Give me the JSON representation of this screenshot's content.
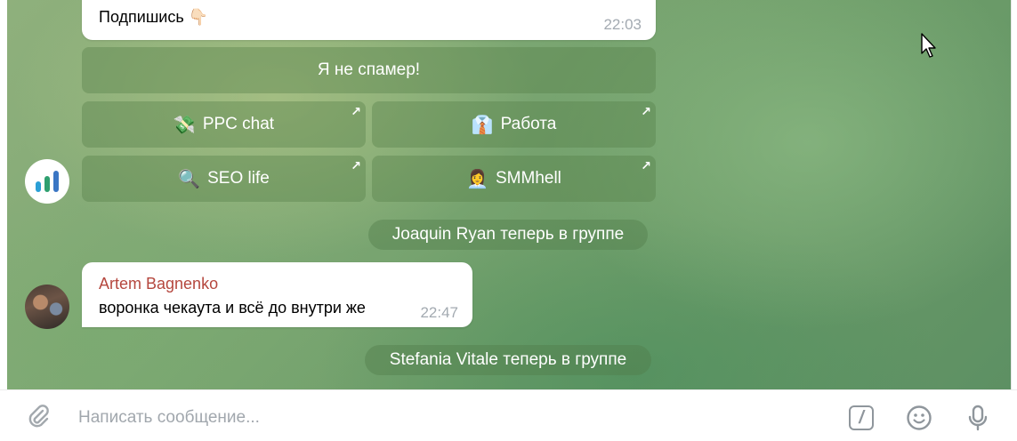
{
  "messages": {
    "top_partial": {
      "text": "Подпишись 👇🏻",
      "time": "22:03"
    },
    "keyboard": {
      "wide_button": "Я не спамер!",
      "buttons": [
        {
          "emoji": "💸",
          "label": "PPC chat"
        },
        {
          "emoji": "👔",
          "label": "Работа"
        },
        {
          "emoji": "🔍",
          "label": "SEO life"
        },
        {
          "emoji": "👩‍💼",
          "label": "SMMhell"
        }
      ],
      "link_arrow": "↗"
    },
    "service_1": "Joaquin Ryan теперь в группе",
    "artem": {
      "sender": "Artem Bagnenko",
      "text": "воронка чекаута и всё до внутри же",
      "time": "22:47"
    },
    "service_2": "Stefania Vitale теперь в группе"
  },
  "composer": {
    "placeholder": "Написать сообщение...",
    "commands_label": "/"
  },
  "colors": {
    "sender_name": "#b5473e",
    "bot_avatar_bars": [
      "#2a9fd6",
      "#2e9f6f",
      "#3a76c4"
    ]
  },
  "icons": [
    "attach-icon",
    "commands-icon",
    "emoji-icon",
    "microphone-icon",
    "cursor-icon"
  ]
}
